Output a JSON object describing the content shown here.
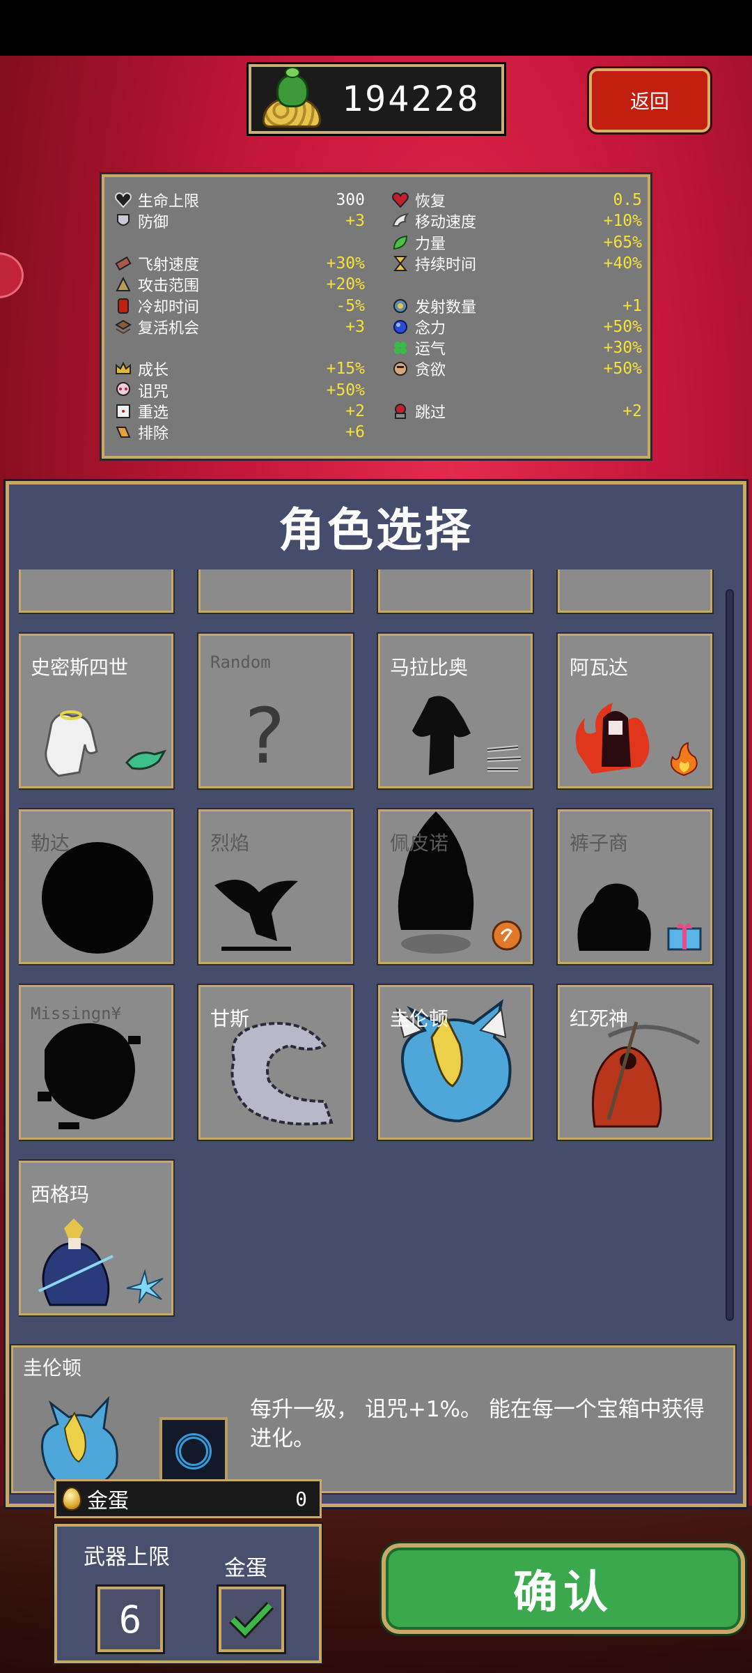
{
  "header": {
    "gold_amount": "194228",
    "back_label": "返回"
  },
  "stats": {
    "left": [
      {
        "label": "生命上限",
        "value": "300",
        "icon": "heart-icon",
        "white": true
      },
      {
        "label": "防御",
        "value": "+3",
        "icon": "armor-icon"
      },
      {
        "label": "",
        "value": "",
        "icon": ""
      },
      {
        "label": "飞射速度",
        "value": "+30%",
        "icon": "speed-icon"
      },
      {
        "label": "攻击范围",
        "value": "+20%",
        "icon": "area-icon"
      },
      {
        "label": "冷却时间",
        "value": "-5%",
        "icon": "cooldown-icon"
      },
      {
        "label": "复活机会",
        "value": "+3",
        "icon": "revival-icon"
      },
      {
        "label": "",
        "value": "",
        "icon": ""
      },
      {
        "label": "成长",
        "value": "+15%",
        "icon": "crown-icon"
      },
      {
        "label": "诅咒",
        "value": "+50%",
        "icon": "skull-icon"
      },
      {
        "label": "重选",
        "value": "+2",
        "icon": "dice-icon"
      },
      {
        "label": "排除",
        "value": "+6",
        "icon": "banish-icon"
      }
    ],
    "right": [
      {
        "label": "恢复",
        "value": "0.5",
        "icon": "recovery-icon"
      },
      {
        "label": "移动速度",
        "value": "+10%",
        "icon": "wing-icon"
      },
      {
        "label": "力量",
        "value": "+65%",
        "icon": "leaf-icon"
      },
      {
        "label": "持续时间",
        "value": "+40%",
        "icon": "hourglass-icon"
      },
      {
        "label": "",
        "value": "",
        "icon": ""
      },
      {
        "label": "发射数量",
        "value": "+1",
        "icon": "amount-icon"
      },
      {
        "label": "念力",
        "value": "+50%",
        "icon": "orb-icon"
      },
      {
        "label": "运气",
        "value": "+30%",
        "icon": "clover-icon"
      },
      {
        "label": "贪欲",
        "value": "+50%",
        "icon": "greed-icon"
      },
      {
        "label": "",
        "value": "",
        "icon": ""
      },
      {
        "label": "跳过",
        "value": "+2",
        "icon": "skip-icon"
      }
    ]
  },
  "main": {
    "title": "角色选择",
    "characters": [
      {
        "name": "史密斯四世",
        "locked": false
      },
      {
        "name": "Random",
        "locked": true
      },
      {
        "name": "马拉比奥",
        "locked": false
      },
      {
        "name": "阿瓦达",
        "locked": false
      },
      {
        "name": "勒达",
        "locked": true
      },
      {
        "name": "烈焰",
        "locked": true
      },
      {
        "name": "佩皮诺",
        "locked": true
      },
      {
        "name": "裤子商",
        "locked": true
      },
      {
        "name": "Missingn¥",
        "locked": true
      },
      {
        "name": "甘斯",
        "locked": false
      },
      {
        "name": "圭伦顿",
        "locked": false
      },
      {
        "name": "红死神",
        "locked": false
      },
      {
        "name": "西格玛",
        "locked": false
      }
    ]
  },
  "description": {
    "name": "圭伦顿",
    "text": "每升一级， 诅咒+1%。 能在每一个宝箱中获得进化。"
  },
  "bottom": {
    "egg_label": "金蛋",
    "egg_count": "0",
    "weapon_limit_label": "武器上限",
    "weapon_limit_value": "6",
    "golden_egg_label": "金蛋",
    "confirm_label": "确认"
  },
  "colors": {
    "background_red": "#c3163a",
    "panel_blue": "#464c6c",
    "gold_border": "#c9a96a",
    "stat_value": "#f4e23a",
    "confirm_green": "#3ca84e",
    "back_red": "#c21f10"
  }
}
